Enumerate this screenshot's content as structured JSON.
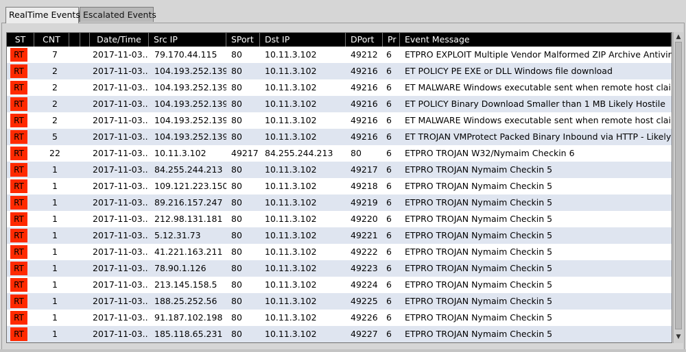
{
  "tabs": [
    {
      "label": "RealTime Events",
      "active": true
    },
    {
      "label": "Escalated Events",
      "active": false
    }
  ],
  "columns": [
    "ST",
    "CNT",
    "",
    "",
    "Date/Time",
    "Src IP",
    "SPort",
    "Dst IP",
    "DPort",
    "Pr",
    "Event Message"
  ],
  "colors": {
    "status_badge": "#ff2a00",
    "row_alt": "#dfe5f0",
    "header_bg": "#000000"
  },
  "rows": [
    {
      "st": "RT",
      "cnt": "7",
      "dt": "2017-11-03...",
      "src": "79.170.44.115",
      "sport": "80",
      "dst": "10.11.3.102",
      "dport": "49212",
      "pr": "6",
      "msg": "ETPRO EXPLOIT Multiple Vendor Malformed ZIP Archive Antiviru..."
    },
    {
      "st": "RT",
      "cnt": "2",
      "dt": "2017-11-03...",
      "src": "104.193.252.139",
      "sport": "80",
      "dst": "10.11.3.102",
      "dport": "49216",
      "pr": "6",
      "msg": "ET POLICY PE EXE or DLL Windows file download"
    },
    {
      "st": "RT",
      "cnt": "2",
      "dt": "2017-11-03...",
      "src": "104.193.252.139",
      "sport": "80",
      "dst": "10.11.3.102",
      "dport": "49216",
      "pr": "6",
      "msg": "ET MALWARE Windows executable sent when remote host clai..."
    },
    {
      "st": "RT",
      "cnt": "2",
      "dt": "2017-11-03...",
      "src": "104.193.252.139",
      "sport": "80",
      "dst": "10.11.3.102",
      "dport": "49216",
      "pr": "6",
      "msg": "ET POLICY Binary Download Smaller than 1 MB Likely Hostile"
    },
    {
      "st": "RT",
      "cnt": "2",
      "dt": "2017-11-03...",
      "src": "104.193.252.139",
      "sport": "80",
      "dst": "10.11.3.102",
      "dport": "49216",
      "pr": "6",
      "msg": "ET MALWARE Windows executable sent when remote host clai..."
    },
    {
      "st": "RT",
      "cnt": "5",
      "dt": "2017-11-03...",
      "src": "104.193.252.139",
      "sport": "80",
      "dst": "10.11.3.102",
      "dport": "49216",
      "pr": "6",
      "msg": "ET TROJAN VMProtect Packed Binary Inbound via HTTP - Likely ..."
    },
    {
      "st": "RT",
      "cnt": "22",
      "dt": "2017-11-03...",
      "src": "10.11.3.102",
      "sport": "49217",
      "dst": "84.255.244.213",
      "dport": "80",
      "pr": "6",
      "msg": "ETPRO TROJAN W32/Nymaim Checkin 6"
    },
    {
      "st": "RT",
      "cnt": "1",
      "dt": "2017-11-03...",
      "src": "84.255.244.213",
      "sport": "80",
      "dst": "10.11.3.102",
      "dport": "49217",
      "pr": "6",
      "msg": "ETPRO TROJAN Nymaim Checkin 5"
    },
    {
      "st": "RT",
      "cnt": "1",
      "dt": "2017-11-03...",
      "src": "109.121.223.150",
      "sport": "80",
      "dst": "10.11.3.102",
      "dport": "49218",
      "pr": "6",
      "msg": "ETPRO TROJAN Nymaim Checkin 5"
    },
    {
      "st": "RT",
      "cnt": "1",
      "dt": "2017-11-03...",
      "src": "89.216.157.247",
      "sport": "80",
      "dst": "10.11.3.102",
      "dport": "49219",
      "pr": "6",
      "msg": "ETPRO TROJAN Nymaim Checkin 5"
    },
    {
      "st": "RT",
      "cnt": "1",
      "dt": "2017-11-03...",
      "src": "212.98.131.181",
      "sport": "80",
      "dst": "10.11.3.102",
      "dport": "49220",
      "pr": "6",
      "msg": "ETPRO TROJAN Nymaim Checkin 5"
    },
    {
      "st": "RT",
      "cnt": "1",
      "dt": "2017-11-03...",
      "src": "5.12.31.73",
      "sport": "80",
      "dst": "10.11.3.102",
      "dport": "49221",
      "pr": "6",
      "msg": "ETPRO TROJAN Nymaim Checkin 5"
    },
    {
      "st": "RT",
      "cnt": "1",
      "dt": "2017-11-03...",
      "src": "41.221.163.211",
      "sport": "80",
      "dst": "10.11.3.102",
      "dport": "49222",
      "pr": "6",
      "msg": "ETPRO TROJAN Nymaim Checkin 5"
    },
    {
      "st": "RT",
      "cnt": "1",
      "dt": "2017-11-03...",
      "src": "78.90.1.126",
      "sport": "80",
      "dst": "10.11.3.102",
      "dport": "49223",
      "pr": "6",
      "msg": "ETPRO TROJAN Nymaim Checkin 5"
    },
    {
      "st": "RT",
      "cnt": "1",
      "dt": "2017-11-03...",
      "src": "213.145.158.5",
      "sport": "80",
      "dst": "10.11.3.102",
      "dport": "49224",
      "pr": "6",
      "msg": "ETPRO TROJAN Nymaim Checkin 5"
    },
    {
      "st": "RT",
      "cnt": "1",
      "dt": "2017-11-03...",
      "src": "188.25.252.56",
      "sport": "80",
      "dst": "10.11.3.102",
      "dport": "49225",
      "pr": "6",
      "msg": "ETPRO TROJAN Nymaim Checkin 5"
    },
    {
      "st": "RT",
      "cnt": "1",
      "dt": "2017-11-03...",
      "src": "91.187.102.198",
      "sport": "80",
      "dst": "10.11.3.102",
      "dport": "49226",
      "pr": "6",
      "msg": "ETPRO TROJAN Nymaim Checkin 5"
    },
    {
      "st": "RT",
      "cnt": "1",
      "dt": "2017-11-03...",
      "src": "185.118.65.231",
      "sport": "80",
      "dst": "10.11.3.102",
      "dport": "49227",
      "pr": "6",
      "msg": "ETPRO TROJAN Nymaim Checkin 5"
    }
  ]
}
